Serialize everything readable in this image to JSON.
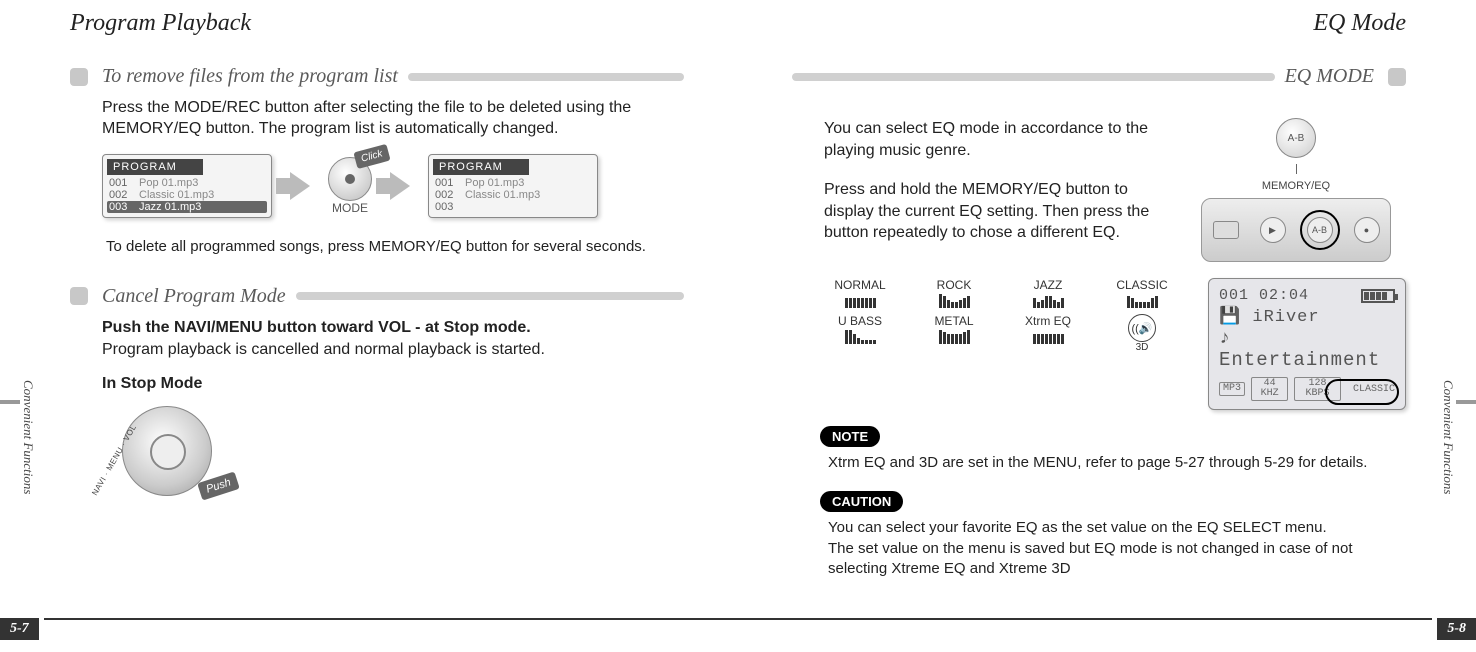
{
  "left": {
    "title": "Program Playback",
    "side_label": "Convenient Functions",
    "page_num": "5-7",
    "sec1": {
      "heading": "To remove files from the program list",
      "body1": "Press the MODE/REC button after selecting the file to be deleted using the MEMORY/EQ button.  The program list is automatically changed.",
      "body2": "To delete all programmed songs, press MEMORY/EQ button for several seconds.",
      "lcd_head": "PROGRAM",
      "lcd_before": [
        {
          "n": "001",
          "t": "Pop 01.mp3"
        },
        {
          "n": "002",
          "t": "Classic 01.mp3"
        },
        {
          "n": "003",
          "t": "Jazz 01.mp3"
        }
      ],
      "lcd_after": [
        {
          "n": "001",
          "t": "Pop 01.mp3"
        },
        {
          "n": "002",
          "t": "Classic 01.mp3"
        },
        {
          "n": "003",
          "t": ""
        }
      ],
      "mode_label": "MODE",
      "click": "Click"
    },
    "sec2": {
      "heading": "Cancel Program Mode",
      "bold": "Push the NAVI/MENU button toward VOL - at Stop mode.",
      "body": "Program playback is cancelled and normal playback is started.",
      "instop": "In Stop Mode",
      "navi_label": "NAVI · MENU · VOL",
      "push": "Push"
    }
  },
  "right": {
    "title": "EQ Mode",
    "side_label": "Convenient Functions",
    "page_num": "5-8",
    "heading_right": "EQ MODE",
    "intro1": "You can select EQ mode in accordance to the playing music genre.",
    "intro2": "Press and hold the MEMORY/EQ button to display the current EQ setting. Then press the button repeatedly to chose a different EQ.",
    "ab_label": "A-B",
    "mem_label": "MEMORY/EQ",
    "presets": [
      "NORMAL",
      "ROCK",
      "JAZZ",
      "CLASSIC",
      "U BASS",
      "METAL",
      "Xtrm EQ"
    ],
    "threeD": "3D",
    "player": {
      "time": "001 02:04",
      "line2": "iRiver",
      "line3": "Entertainment",
      "chips": [
        "MP3",
        "44 KHZ",
        "128 KBPS"
      ],
      "classic": "CLASSIC"
    },
    "note_label": "NOTE",
    "note_text": "Xtrm EQ and 3D are set in the MENU, refer to page 5-27 through 5-29 for details.",
    "caution_label": "CAUTION",
    "caution_text": "You can select your favorite EQ as the set value on the EQ SELECT menu.\nThe set value on the menu is saved but EQ mode is not changed in case of not selecting Xtreme EQ and Xtreme 3D"
  }
}
